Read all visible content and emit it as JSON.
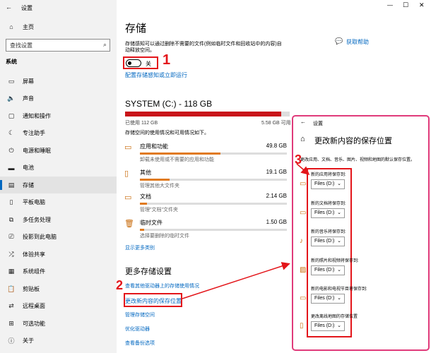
{
  "window": {
    "title": "设置",
    "controls": {
      "minimize": "—",
      "maximize": "☐",
      "close": "✕"
    }
  },
  "sidebar": {
    "home": "主页",
    "search_placeholder": "查找设置",
    "section": "系统",
    "items": [
      {
        "label": "屏幕",
        "icon": "monitor-icon"
      },
      {
        "label": "声音",
        "icon": "speaker-icon"
      },
      {
        "label": "通知和操作",
        "icon": "notification-icon"
      },
      {
        "label": "专注助手",
        "icon": "moon-icon"
      },
      {
        "label": "电源和睡眠",
        "icon": "power-icon"
      },
      {
        "label": "电池",
        "icon": "battery-icon"
      },
      {
        "label": "存储",
        "icon": "storage-icon"
      },
      {
        "label": "平板电脑",
        "icon": "tablet-icon"
      },
      {
        "label": "多任务处理",
        "icon": "multitask-icon"
      },
      {
        "label": "投影到此电脑",
        "icon": "project-icon"
      },
      {
        "label": "体验共享",
        "icon": "share-icon"
      },
      {
        "label": "系统组件",
        "icon": "components-icon"
      },
      {
        "label": "剪贴板",
        "icon": "clipboard-icon"
      },
      {
        "label": "远程桌面",
        "icon": "remote-icon"
      },
      {
        "label": "可选功能",
        "icon": "optional-icon"
      },
      {
        "label": "关于",
        "icon": "info-icon"
      }
    ],
    "active_index": 6
  },
  "main": {
    "title": "存储",
    "sense_desc": "存储感知可以通过删除不需要的文件(例如临时文件和回收站中的内容)自动释放空间。",
    "toggle_label": "关",
    "configure_link": "配置存储感知或立即运行",
    "help_link": "获取帮助",
    "drive": {
      "title": "SYSTEM (C:) - 118 GB",
      "used": "已使用 112 GB",
      "free": "5.58 GB 可用",
      "used_fraction": 0.95,
      "desc": "存储空间的使用情况和可用情况如下。"
    },
    "categories": [
      {
        "name": "应用和功能",
        "size": "49.8 GB",
        "desc": "卸载未使用或不需要的应用和功能",
        "fraction": 0.55,
        "icon": "apps-icon"
      },
      {
        "name": "其他",
        "size": "19.1 GB",
        "desc": "管理其他大文件夹",
        "fraction": 0.2,
        "icon": "document-icon"
      },
      {
        "name": "文档",
        "size": "2.14 GB",
        "desc": "管理\"文档\"文件夹",
        "fraction": 0.05,
        "icon": "folder-icon"
      },
      {
        "name": "临时文件",
        "size": "1.50 GB",
        "desc": "选择要删除的临时文件",
        "fraction": 0.03,
        "icon": "trash-icon"
      }
    ],
    "show_more": "显示更多类别",
    "more_title": "更多存储设置",
    "more_links": [
      "查看其他驱动器上的存储使用情况",
      "更改新内容的保存位置",
      "管理存储空间",
      "优化驱动器",
      "查看备份选项"
    ]
  },
  "overlay": {
    "back_label": "设置",
    "title": "更改新内容的保存位置",
    "desc": "更改应用、文档、音乐、图片、视频和地图的默认保存位置。",
    "groups": [
      {
        "label": "新的应用将保存到:",
        "value": "Files (D:)",
        "icon": "monitor-icon"
      },
      {
        "label": "新的文档将保存到:",
        "value": "Files (D:)",
        "icon": "folder-icon"
      },
      {
        "label": "新的音乐将保存到:",
        "value": "Files (D:)",
        "icon": "music-icon"
      },
      {
        "label": "新的照片和视频将保存到:",
        "value": "Files (D:)",
        "icon": "picture-icon"
      },
      {
        "label": "新的电影和电视节目将保存到:",
        "value": "Files (D:)",
        "icon": "video-icon"
      },
      {
        "label": "更改离线地图的存储位置",
        "value": "Files (D:)",
        "icon": "map-icon"
      }
    ]
  },
  "annotations": {
    "n1": "1",
    "n2": "2",
    "n3": "3"
  },
  "colors": {
    "accent": "#0067c0",
    "annotation": "#e3151a",
    "drive_bar": "#c9151a",
    "category_bar": "#e07a1e"
  }
}
